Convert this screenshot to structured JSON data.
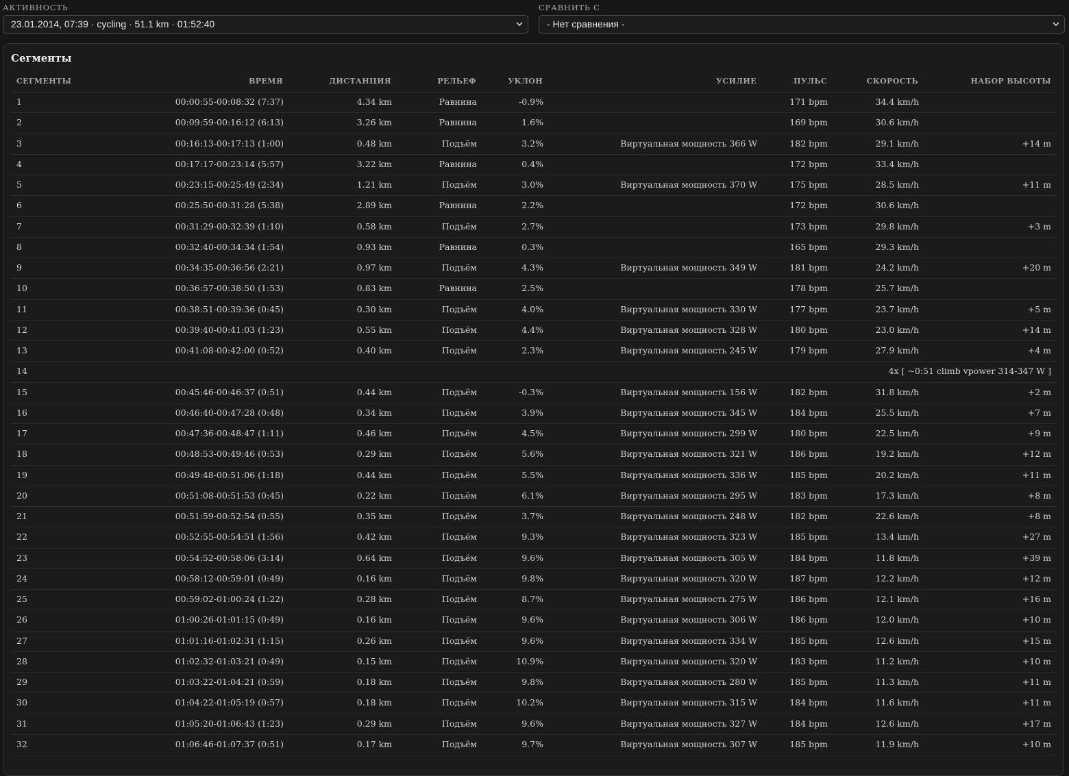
{
  "activity": {
    "label": "АКТИВНОСТЬ",
    "value": "23.01.2014, 07:39 · cycling · 51.1 km · 01:52:40"
  },
  "compare": {
    "label": "СРАВНИТЬ С",
    "value": "- Нет сравнения -"
  },
  "segments": {
    "title": "Сегменты",
    "headers": {
      "segment": "СЕГМЕНТЫ",
      "time": "ВРЕМЯ",
      "distance": "ДИСТАНЦИЯ",
      "terrain": "РЕЛЬЕФ",
      "grade": "УКЛОН",
      "effort": "УСИЛИЕ",
      "hr": "ПУЛЬС",
      "speed": "СКОРОСТЬ",
      "elevation": "НАБОР ВЫСОТЫ"
    },
    "rows": [
      {
        "num": "1",
        "time": "00:00:55-00:08:32 (7:37)",
        "distance": "4.34 km",
        "terrain": "Равнина",
        "grade": "-0.9%",
        "effort": "",
        "hr": "171 bpm",
        "speed": "34.4 km/h",
        "elevation": ""
      },
      {
        "num": "2",
        "time": "00:09:59-00:16:12 (6:13)",
        "distance": "3.26 km",
        "terrain": "Равнина",
        "grade": "1.6%",
        "effort": "",
        "hr": "169 bpm",
        "speed": "30.6 km/h",
        "elevation": ""
      },
      {
        "num": "3",
        "time": "00:16:13-00:17:13 (1:00)",
        "distance": "0.48 km",
        "terrain": "Подъём",
        "grade": "3.2%",
        "effort": "Виртуальная мощность 366 W",
        "hr": "182 bpm",
        "speed": "29.1 km/h",
        "elevation": "+14 m"
      },
      {
        "num": "4",
        "time": "00:17:17-00:23:14 (5:57)",
        "distance": "3.22 km",
        "terrain": "Равнина",
        "grade": "0.4%",
        "effort": "",
        "hr": "172 bpm",
        "speed": "33.4 km/h",
        "elevation": ""
      },
      {
        "num": "5",
        "time": "00:23:15-00:25:49 (2:34)",
        "distance": "1.21 km",
        "terrain": "Подъём",
        "grade": "3.0%",
        "effort": "Виртуальная мощность 370 W",
        "hr": "175 bpm",
        "speed": "28.5 km/h",
        "elevation": "+11 m"
      },
      {
        "num": "6",
        "time": "00:25:50-00:31:28 (5:38)",
        "distance": "2.89 km",
        "terrain": "Равнина",
        "grade": "2.2%",
        "effort": "",
        "hr": "172 bpm",
        "speed": "30.6 km/h",
        "elevation": ""
      },
      {
        "num": "7",
        "time": "00:31:29-00:32:39 (1:10)",
        "distance": "0.58 km",
        "terrain": "Подъём",
        "grade": "2.7%",
        "effort": "",
        "hr": "173 bpm",
        "speed": "29.8 km/h",
        "elevation": "+3 m"
      },
      {
        "num": "8",
        "time": "00:32:40-00:34:34 (1:54)",
        "distance": "0.93 km",
        "terrain": "Равнина",
        "grade": "0.3%",
        "effort": "",
        "hr": "165 bpm",
        "speed": "29.3 km/h",
        "elevation": ""
      },
      {
        "num": "9",
        "time": "00:34:35-00:36:56 (2:21)",
        "distance": "0.97 km",
        "terrain": "Подъём",
        "grade": "4.3%",
        "effort": "Виртуальная мощность 349 W",
        "hr": "181 bpm",
        "speed": "24.2 km/h",
        "elevation": "+20 m"
      },
      {
        "num": "10",
        "time": "00:36:57-00:38:50 (1:53)",
        "distance": "0.83 km",
        "terrain": "Равнина",
        "grade": "2.5%",
        "effort": "",
        "hr": "178 bpm",
        "speed": "25.7 km/h",
        "elevation": ""
      },
      {
        "num": "11",
        "time": "00:38:51-00:39:36 (0:45)",
        "distance": "0.30 km",
        "terrain": "Подъём",
        "grade": "4.0%",
        "effort": "Виртуальная мощность 330 W",
        "hr": "177 bpm",
        "speed": "23.7 km/h",
        "elevation": "+5 m"
      },
      {
        "num": "12",
        "time": "00:39:40-00:41:03 (1:23)",
        "distance": "0.55 km",
        "terrain": "Подъём",
        "grade": "4.4%",
        "effort": "Виртуальная мощность 328 W",
        "hr": "180 bpm",
        "speed": "23.0 km/h",
        "elevation": "+14 m"
      },
      {
        "num": "13",
        "time": "00:41:08-00:42:00 (0:52)",
        "distance": "0.40 km",
        "terrain": "Подъём",
        "grade": "2.3%",
        "effort": "Виртуальная мощность 245 W",
        "hr": "179 bpm",
        "speed": "27.9 km/h",
        "elevation": "+4 m"
      },
      {
        "num": "14",
        "summary": "4x [ ~0:51 climb vpower 314-347 W ]"
      },
      {
        "num": "15",
        "time": "00:45:46-00:46:37 (0:51)",
        "distance": "0.44 km",
        "terrain": "Подъём",
        "grade": "-0.3%",
        "effort": "Виртуальная мощность 156 W",
        "hr": "182 bpm",
        "speed": "31.8 km/h",
        "elevation": "+2 m"
      },
      {
        "num": "16",
        "time": "00:46:40-00:47:28 (0:48)",
        "distance": "0.34 km",
        "terrain": "Подъём",
        "grade": "3.9%",
        "effort": "Виртуальная мощность 345 W",
        "hr": "184 bpm",
        "speed": "25.5 km/h",
        "elevation": "+7 m"
      },
      {
        "num": "17",
        "time": "00:47:36-00:48:47 (1:11)",
        "distance": "0.46 km",
        "terrain": "Подъём",
        "grade": "4.5%",
        "effort": "Виртуальная мощность 299 W",
        "hr": "180 bpm",
        "speed": "22.5 km/h",
        "elevation": "+9 m"
      },
      {
        "num": "18",
        "time": "00:48:53-00:49:46 (0:53)",
        "distance": "0.29 km",
        "terrain": "Подъём",
        "grade": "5.6%",
        "effort": "Виртуальная мощность 321 W",
        "hr": "186 bpm",
        "speed": "19.2 km/h",
        "elevation": "+12 m"
      },
      {
        "num": "19",
        "time": "00:49:48-00:51:06 (1:18)",
        "distance": "0.44 km",
        "terrain": "Подъём",
        "grade": "5.5%",
        "effort": "Виртуальная мощность 336 W",
        "hr": "185 bpm",
        "speed": "20.2 km/h",
        "elevation": "+11 m"
      },
      {
        "num": "20",
        "time": "00:51:08-00:51:53 (0:45)",
        "distance": "0.22 km",
        "terrain": "Подъём",
        "grade": "6.1%",
        "effort": "Виртуальная мощность 295 W",
        "hr": "183 bpm",
        "speed": "17.3 km/h",
        "elevation": "+8 m"
      },
      {
        "num": "21",
        "time": "00:51:59-00:52:54 (0:55)",
        "distance": "0.35 km",
        "terrain": "Подъём",
        "grade": "3.7%",
        "effort": "Виртуальная мощность 248 W",
        "hr": "182 bpm",
        "speed": "22.6 km/h",
        "elevation": "+8 m"
      },
      {
        "num": "22",
        "time": "00:52:55-00:54:51 (1:56)",
        "distance": "0.42 km",
        "terrain": "Подъём",
        "grade": "9.3%",
        "effort": "Виртуальная мощность 323 W",
        "hr": "185 bpm",
        "speed": "13.4 km/h",
        "elevation": "+27 m"
      },
      {
        "num": "23",
        "time": "00:54:52-00:58:06 (3:14)",
        "distance": "0.64 km",
        "terrain": "Подъём",
        "grade": "9.6%",
        "effort": "Виртуальная мощность 305 W",
        "hr": "184 bpm",
        "speed": "11.8 km/h",
        "elevation": "+39 m"
      },
      {
        "num": "24",
        "time": "00:58:12-00:59:01 (0:49)",
        "distance": "0.16 km",
        "terrain": "Подъём",
        "grade": "9.8%",
        "effort": "Виртуальная мощность 320 W",
        "hr": "187 bpm",
        "speed": "12.2 km/h",
        "elevation": "+12 m"
      },
      {
        "num": "25",
        "time": "00:59:02-01:00:24 (1:22)",
        "distance": "0.28 km",
        "terrain": "Подъём",
        "grade": "8.7%",
        "effort": "Виртуальная мощность 275 W",
        "hr": "186 bpm",
        "speed": "12.1 km/h",
        "elevation": "+16 m"
      },
      {
        "num": "26",
        "time": "01:00:26-01:01:15 (0:49)",
        "distance": "0.16 km",
        "terrain": "Подъём",
        "grade": "9.6%",
        "effort": "Виртуальная мощность 306 W",
        "hr": "186 bpm",
        "speed": "12.0 km/h",
        "elevation": "+10 m"
      },
      {
        "num": "27",
        "time": "01:01:16-01:02:31 (1:15)",
        "distance": "0.26 km",
        "terrain": "Подъём",
        "grade": "9.6%",
        "effort": "Виртуальная мощность 334 W",
        "hr": "185 bpm",
        "speed": "12.6 km/h",
        "elevation": "+15 m"
      },
      {
        "num": "28",
        "time": "01:02:32-01:03:21 (0:49)",
        "distance": "0.15 km",
        "terrain": "Подъём",
        "grade": "10.9%",
        "effort": "Виртуальная мощность 320 W",
        "hr": "183 bpm",
        "speed": "11.2 km/h",
        "elevation": "+10 m"
      },
      {
        "num": "29",
        "time": "01:03:22-01:04:21 (0:59)",
        "distance": "0.18 km",
        "terrain": "Подъём",
        "grade": "9.8%",
        "effort": "Виртуальная мощность 280 W",
        "hr": "185 bpm",
        "speed": "11.3 km/h",
        "elevation": "+11 m"
      },
      {
        "num": "30",
        "time": "01:04:22-01:05:19 (0:57)",
        "distance": "0.18 km",
        "terrain": "Подъём",
        "grade": "10.2%",
        "effort": "Виртуальная мощность 315 W",
        "hr": "184 bpm",
        "speed": "11.6 km/h",
        "elevation": "+11 m"
      },
      {
        "num": "31",
        "time": "01:05:20-01:06:43 (1:23)",
        "distance": "0.29 km",
        "terrain": "Подъём",
        "grade": "9.6%",
        "effort": "Виртуальная мощность 327 W",
        "hr": "184 bpm",
        "speed": "12.6 km/h",
        "elevation": "+17 m"
      },
      {
        "num": "32",
        "time": "01:06:46-01:07:37 (0:51)",
        "distance": "0.17 km",
        "terrain": "Подъём",
        "grade": "9.7%",
        "effort": "Виртуальная мощность 307 W",
        "hr": "185 bpm",
        "speed": "11.9 km/h",
        "elevation": "+10 m"
      }
    ]
  }
}
